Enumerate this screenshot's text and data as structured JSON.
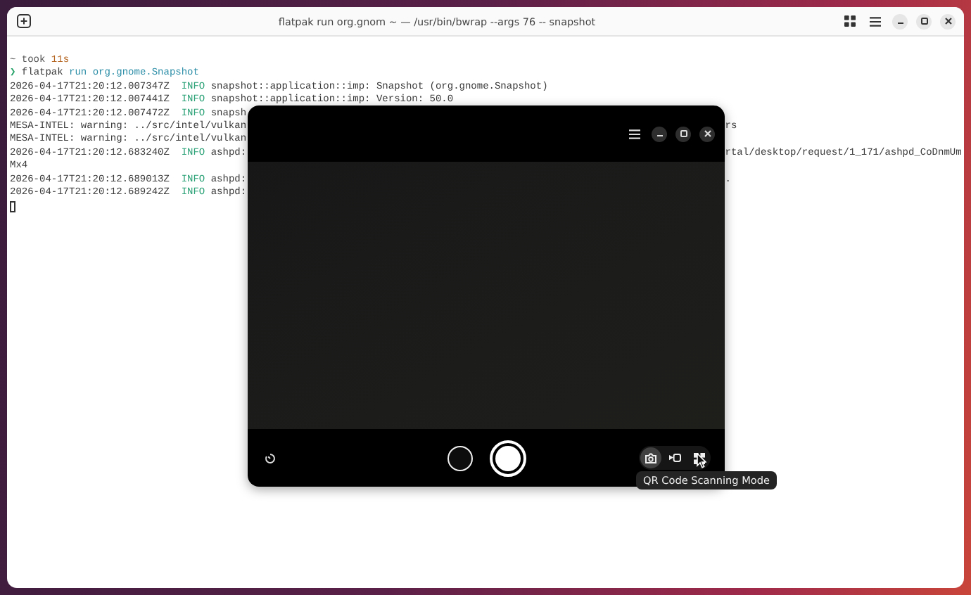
{
  "terminal": {
    "title": "flatpak run org.gnom ~ — /usr/bin/bwrap --args 76 -- snapshot",
    "lines": [
      {
        "segments": [
          {
            "kind": "dim",
            "text": "~ took"
          },
          {
            "kind": "number",
            "text": "11s"
          }
        ]
      },
      {
        "segments": [
          {
            "kind": "prompt",
            "text": "❯"
          },
          {
            "kind": "plain",
            "text": "flatpak"
          },
          {
            "kind": "arg",
            "text": "run org.gnome.Snapshot"
          }
        ]
      },
      {
        "segments": [
          {
            "kind": "plain",
            "text": "2026-04-17T21:20:12.007347Z"
          },
          {
            "kind": "info",
            "text": "INFO"
          },
          {
            "kind": "plain",
            "text": "snapshot::application::imp: Snapshot (org.gnome.Snapshot)"
          }
        ]
      },
      {
        "segments": [
          {
            "kind": "plain",
            "text": "2026-04-17T21:20:12.007441Z"
          },
          {
            "kind": "info",
            "text": "INFO"
          },
          {
            "kind": "plain",
            "text": "snapshot::application::imp: Version: 50.0"
          }
        ]
      },
      {
        "segments": [
          {
            "kind": "plain",
            "text": "2026-04-17T21:20:12.007472Z"
          },
          {
            "kind": "info",
            "text": "INFO"
          },
          {
            "kind": "plain",
            "text": "snapsh"
          }
        ]
      },
      {
        "segments": [
          {
            "kind": "plain",
            "text": "MESA-INTEL: warning: ../src/intel/vulkan"
          }
        ],
        "right": "rs"
      },
      {
        "segments": [
          {
            "kind": "plain",
            "text": "MESA-INTEL: warning: ../src/intel/vulkan"
          }
        ]
      },
      {
        "segments": [
          {
            "kind": "plain",
            "text": "2026-04-17T21:20:12.683240Z"
          },
          {
            "kind": "info",
            "text": "INFO"
          },
          {
            "kind": "plain",
            "text": "ashpd:"
          }
        ],
        "right": "rtal/desktop/request/1_171/ashpd_CoDnmUm"
      },
      {
        "segments": [
          {
            "kind": "plain",
            "text": "Mx4"
          }
        ]
      },
      {
        "segments": [
          {
            "kind": "plain",
            "text": "2026-04-17T21:20:12.689013Z"
          },
          {
            "kind": "info",
            "text": "INFO"
          },
          {
            "kind": "plain",
            "text": "ashpd:"
          }
        ],
        "right": "."
      },
      {
        "segments": [
          {
            "kind": "plain",
            "text": "2026-04-17T21:20:12.689242Z"
          },
          {
            "kind": "info",
            "text": "INFO"
          },
          {
            "kind": "plain",
            "text": "ashpd:"
          }
        ]
      }
    ]
  },
  "snapshot": {
    "modes": [
      {
        "kind": "photo",
        "selected": true
      },
      {
        "kind": "video",
        "selected": false
      },
      {
        "kind": "qr",
        "selected": false
      }
    ],
    "tooltip": "QR Code Scanning Mode"
  }
}
